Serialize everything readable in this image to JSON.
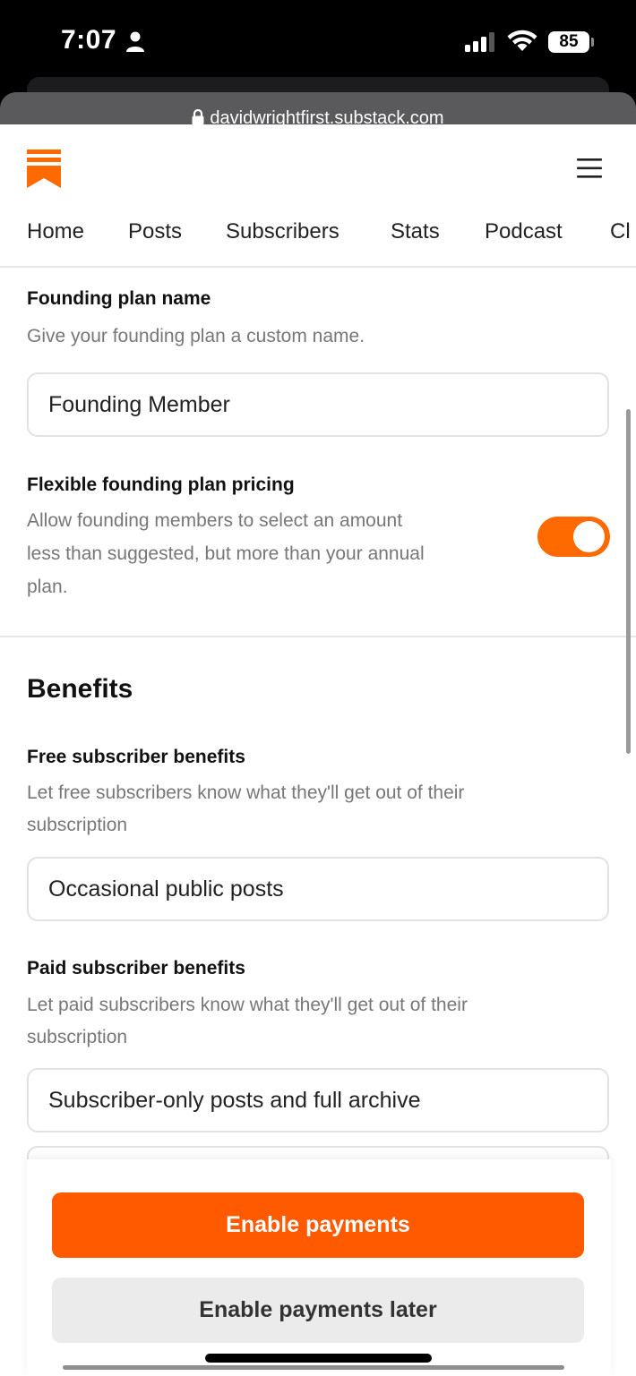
{
  "status_bar": {
    "time": "7:07",
    "battery": "85"
  },
  "browser": {
    "url": "davidwrightfirst.substack.com"
  },
  "header": {
    "logo": "substack-logo",
    "menu_icon": "hamburger-menu-icon"
  },
  "nav": {
    "items": [
      {
        "label": "Home"
      },
      {
        "label": "Posts"
      },
      {
        "label": "Subscribers"
      },
      {
        "label": "Stats"
      },
      {
        "label": "Podcast"
      },
      {
        "label": "Cl"
      }
    ]
  },
  "founding_plan": {
    "label": "Founding plan name",
    "description": "Give your founding plan a custom name.",
    "value": "Founding Member"
  },
  "flexible_pricing": {
    "label": "Flexible founding plan pricing",
    "description_lines": [
      "Allow founding members to select an amount",
      "less than suggested, but more than your annual",
      "plan."
    ],
    "enabled": true,
    "toggle_color": "#ff6a00"
  },
  "benefits": {
    "title": "Benefits",
    "free": {
      "label": "Free subscriber benefits",
      "description_lines": [
        "Let free subscribers know what they'll get out of their",
        "subscription"
      ],
      "value": "Occasional public posts"
    },
    "paid": {
      "label": "Paid subscriber benefits",
      "description_lines": [
        "Let paid subscribers know what they'll get out of their",
        "subscription"
      ],
      "value": "Subscriber-only posts and full archive"
    }
  },
  "actions": {
    "primary": "Enable payments",
    "secondary": "Enable payments later",
    "brand_color": "#ff5a00"
  }
}
